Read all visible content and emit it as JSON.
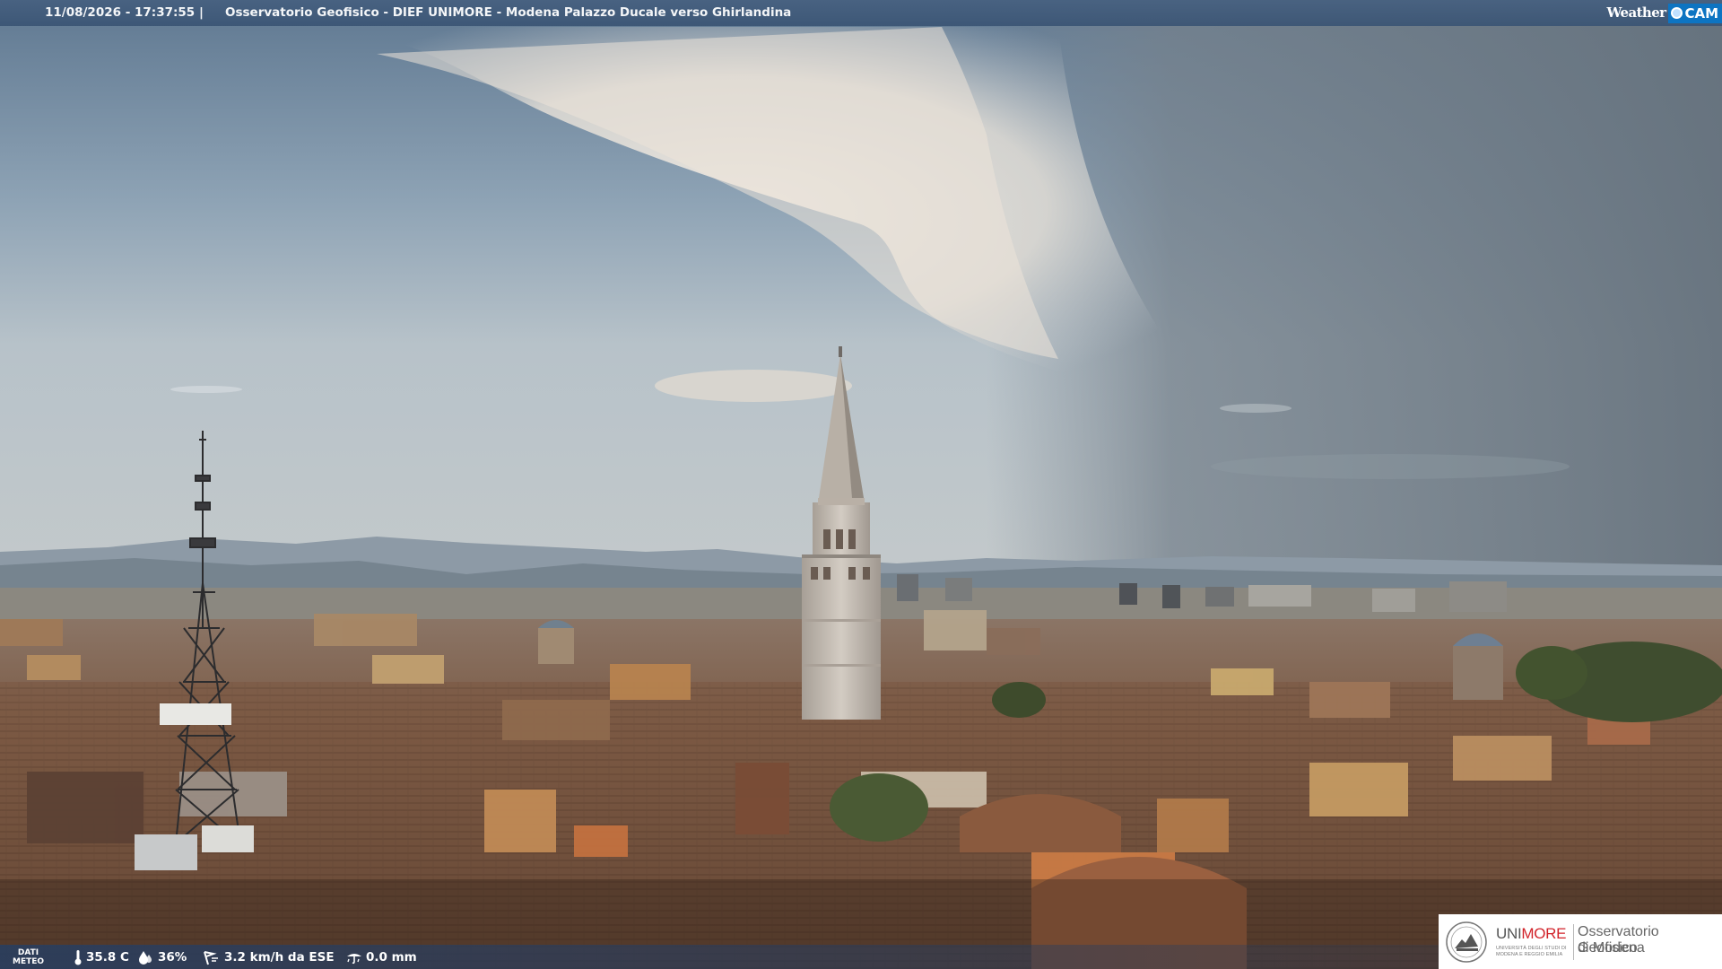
{
  "overlay": {
    "timestamp": "11/08/2026 - 17:37:55",
    "separator": "|",
    "title": "Osservatorio Geofisico - DIEF UNIMORE - Modena Palazzo Ducale verso Ghirlandina",
    "logo": {
      "weather": "Weather",
      "cam": "CAM",
      "brand_color": "#0d74c2"
    }
  },
  "weather_strip": {
    "label_line1": "DATI",
    "label_line2": "METEO",
    "temperature": "35.8 C",
    "humidity": "36%",
    "wind": "3.2 km/h da ESE",
    "rain": "0.0 mm",
    "icons": [
      "thermometer-icon",
      "humidity-drop-icon",
      "wind-icon",
      "rain-gauge-icon"
    ]
  },
  "badge": {
    "uni_name_a": "UNI",
    "uni_name_b": "MORE",
    "uni_sub1": "UNIVERSITÀ DEGLI STUDI DI",
    "uni_sub2": "MODENA E REGGIO EMILIA",
    "observatory_line1": "Osservatorio Geofisico",
    "observatory_line2": "di Modena",
    "accent": "#d2232a"
  },
  "scene": {
    "description_colors": {
      "sky_top": "#5b7590",
      "sky_haze": "#b9c6cf",
      "storm_right": "#6f7b86",
      "cloud_highlight": "#efe8de",
      "roofs": "#7d5a43",
      "tower": "#c9c2b9"
    }
  }
}
